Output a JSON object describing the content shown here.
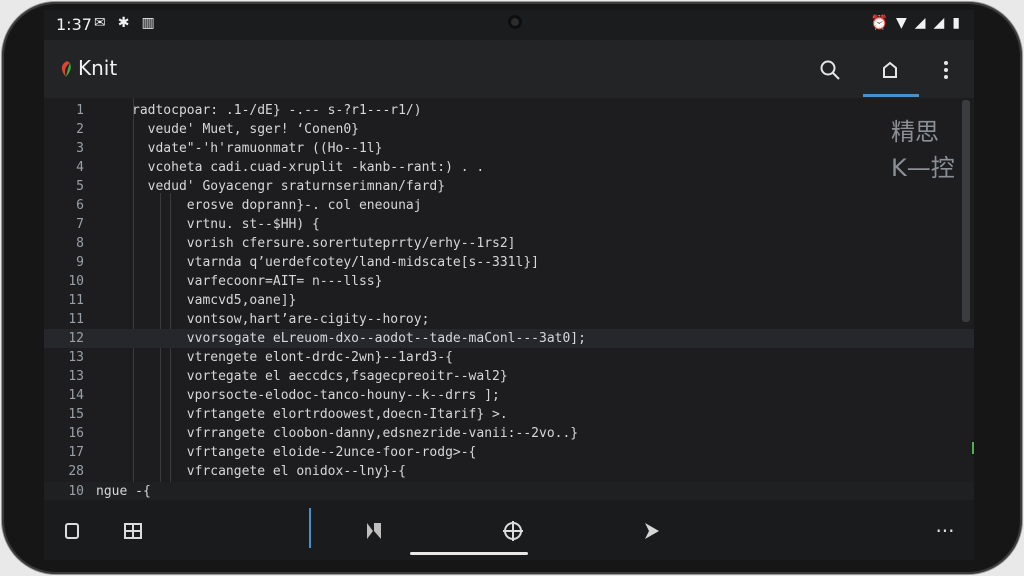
{
  "status": {
    "time": "1:37",
    "left_icons": [
      "notification-icon",
      "app-icon",
      "chart-icon"
    ],
    "right_icons": [
      "alarm-icon",
      "wifi-icon",
      "signal-icon",
      "signal-icon",
      "battery-icon"
    ]
  },
  "app": {
    "title": "Knit",
    "accent": "#4a8fc7"
  },
  "editor": {
    "lines": [
      {
        "num": "1",
        "text": "radtocpoar: .1-/dE} -.-- s-?r1---r1/)"
      },
      {
        "num": "2",
        "text": "  veude' Muet, sger! ‘Conen0}"
      },
      {
        "num": "3",
        "text": "  vdate\"-'h'ramuonmatr ((Ho--1l}"
      },
      {
        "num": "4",
        "text": "  vcoheta cadi.cuad-xruplit -kanb--rant:) . ."
      },
      {
        "num": "5",
        "text": "  vedud' Goyacengr sraturnserimnan/fard}"
      },
      {
        "num": "6",
        "text": "       erosve doprann}-. col eneounaj"
      },
      {
        "num": "7",
        "text": "       vrtnu. st--$HH) {"
      },
      {
        "num": "8",
        "text": "       vorish cfersure.sorertuteprrty/erhy--1rs2]"
      },
      {
        "num": "9",
        "text": "       vtarnda q’uerdefcotey/land-midscate[s--331l}]"
      },
      {
        "num": "10",
        "text": "       varfecoonr=AIT= n---llss}"
      },
      {
        "num": "11",
        "text": "       vamcvd5,oane]}"
      },
      {
        "num": "11",
        "text": "       vontsow,hart’are-cigity--horoy;"
      },
      {
        "num": "12",
        "text": "       vvorsogate eLreuom-dxo--aodot--tade-maConl---3at0];"
      },
      {
        "num": "13",
        "text": "       vtrengete elont-drdc-2wn}--1ard3-{"
      },
      {
        "num": "13",
        "text": "       vortegate el aeccdcs,fsagecpreoitr--wal2}"
      },
      {
        "num": "14",
        "text": "       vporsocte-elodoc-tanco-houny--k--drrs ];"
      },
      {
        "num": "15",
        "text": "       vfrtangete elortrdoowest,doecn-Itarif} >."
      },
      {
        "num": "16",
        "text": "       vfrrangete cloobon-danny,edsnezride-vanii:--2vo..}"
      },
      {
        "num": "17",
        "text": "       vfrtangete eloide--2unce-foor-rodg>-{"
      },
      {
        "num": "28",
        "text": "       vfrcangete el onidox--lny}-{"
      }
    ],
    "current_line_index": 11,
    "bottom_line": {
      "num": "10",
      "text": "ngue -{"
    },
    "overlay": {
      "top": "精思",
      "bottom": "K—控"
    }
  },
  "icons": {
    "search": "search-icon",
    "home": "home-icon",
    "more": "more-vertical-icon",
    "copy": "copy-icon",
    "grid": "grid-icon",
    "bookmark": "bookmark-icon",
    "target": "target-icon",
    "play": "play-icon",
    "overflow": "more-horizontal-icon"
  },
  "bottombar": {
    "overflow_label": "···"
  }
}
